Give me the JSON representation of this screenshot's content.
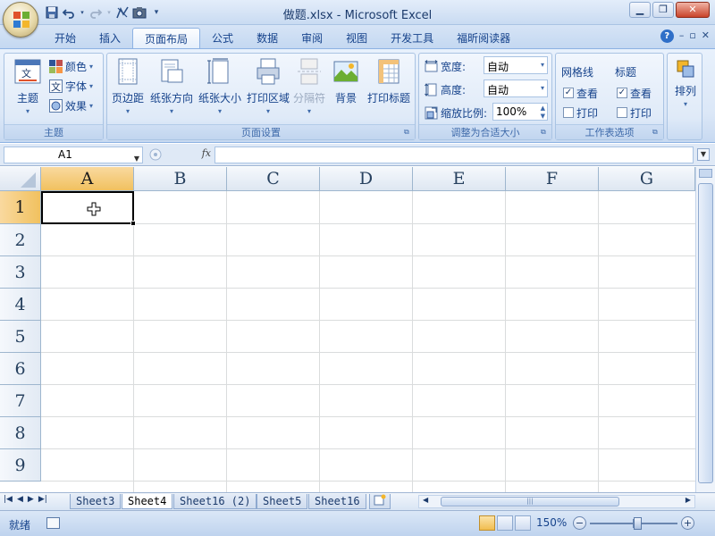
{
  "window": {
    "title": "做题.xlsx - Microsoft Excel",
    "minimize": "▁",
    "restore": "❐",
    "close": "✕"
  },
  "qat": [
    "save-icon",
    "undo-icon",
    "redo-icon",
    "chart-icon",
    "camera-icon",
    "customize-arrow-icon"
  ],
  "tabs": [
    "开始",
    "插入",
    "页面布局",
    "公式",
    "数据",
    "审阅",
    "视图",
    "开发工具",
    "福昕阅读器"
  ],
  "active_tab": "页面布局",
  "tab_right": {
    "help": "?",
    "min": "–",
    "restore": "▫",
    "close": "✕"
  },
  "ribbon": {
    "theme_group": {
      "label": "主题",
      "theme_button": "主题",
      "colors": "颜色",
      "fonts": "字体",
      "effects": "效果"
    },
    "page_setup_group": {
      "label": "页面设置",
      "margins": "页边距",
      "orientation": "纸张方向",
      "size": "纸张大小",
      "print_area": "打印区域",
      "breaks": "分隔符",
      "background": "背景",
      "print_titles": "打印标题"
    },
    "scale_group": {
      "label": "调整为合适大小",
      "width_label": "宽度:",
      "width_value": "自动",
      "height_label": "高度:",
      "height_value": "自动",
      "scale_label": "缩放比例:",
      "scale_value": "100%"
    },
    "sheet_options_group": {
      "label": "工作表选项",
      "gridlines": "网格线",
      "headings": "标题",
      "view": "查看",
      "print": "打印",
      "gridlines_view": true,
      "gridlines_print": false,
      "headings_view": true,
      "headings_print": false
    },
    "arrange_group": {
      "arrange": "排列"
    }
  },
  "formula_bar": {
    "name_box": "A1",
    "fx": "fx",
    "formula": ""
  },
  "grid": {
    "columns": [
      "A",
      "B",
      "C",
      "D",
      "E",
      "F",
      "G"
    ],
    "rows": [
      "1",
      "2",
      "3",
      "4",
      "5",
      "6",
      "7",
      "8",
      "9"
    ],
    "active_cell": "A1"
  },
  "sheets": [
    "Sheet3",
    "Sheet4",
    "Sheet16 (2)",
    "Sheet5",
    "Sheet16"
  ],
  "active_sheet": "Sheet4",
  "status": {
    "ready": "就绪",
    "zoom": "150%",
    "zoom_minus": "−",
    "zoom_plus": "+"
  },
  "colors": {
    "accent": "#15428b",
    "selected_header": "#f1c15f",
    "ribbon_bg": "#dbe7f7"
  }
}
